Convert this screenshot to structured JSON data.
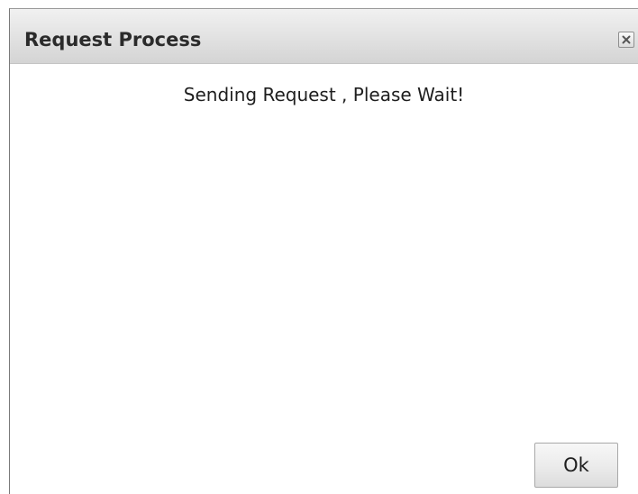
{
  "dialog": {
    "title": "Request Process",
    "message": "Sending Request , Please Wait!",
    "ok_label": "Ok",
    "close_icon": "close-icon"
  },
  "colors": {
    "titlebar_top": "#f1f1f1",
    "titlebar_bottom": "#d4d4d4",
    "title_text": "#2b2b2b",
    "body_bg": "#ffffff",
    "border": "#7a7a7a"
  }
}
